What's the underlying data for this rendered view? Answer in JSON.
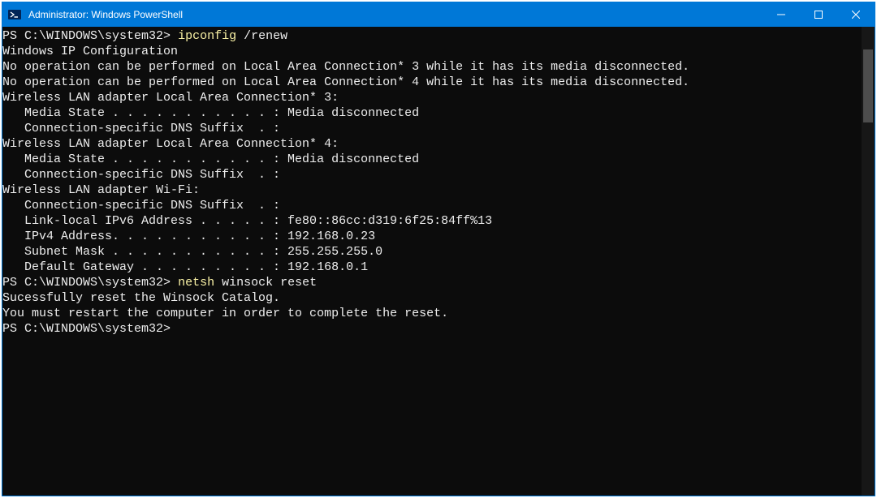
{
  "window": {
    "title": "Administrator: Windows PowerShell"
  },
  "terminal": {
    "prompt": "PS C:\\WINDOWS\\system32>",
    "cmd1_head": "ipconfig",
    "cmd1_tail": " /renew",
    "blank": "",
    "l_ipconfig_header": "Windows IP Configuration",
    "l_noop3": "No operation can be performed on Local Area Connection* 3 while it has its media disconnected.",
    "l_noop4": "No operation can be performed on Local Area Connection* 4 while it has its media disconnected.",
    "l_wlan3_hdr": "Wireless LAN adapter Local Area Connection* 3:",
    "l_media_disc": "   Media State . . . . . . . . . . . : Media disconnected",
    "l_dns_suffix": "   Connection-specific DNS Suffix  . :",
    "l_wlan4_hdr": "Wireless LAN adapter Local Area Connection* 4:",
    "l_wifi_hdr": "Wireless LAN adapter Wi-Fi:",
    "l_linklocal": "   Link-local IPv6 Address . . . . . : fe80::86cc:d319:6f25:84ff%13",
    "l_ipv4": "   IPv4 Address. . . . . . . . . . . : 192.168.0.23",
    "l_subnet": "   Subnet Mask . . . . . . . . . . . : 255.255.255.0",
    "l_gateway": "   Default Gateway . . . . . . . . . : 192.168.0.1",
    "cmd2_head": "netsh",
    "cmd2_tail": " winsock reset",
    "l_reset_ok": "Sucessfully reset the Winsock Catalog.",
    "l_restart": "You must restart the computer in order to complete the reset."
  }
}
